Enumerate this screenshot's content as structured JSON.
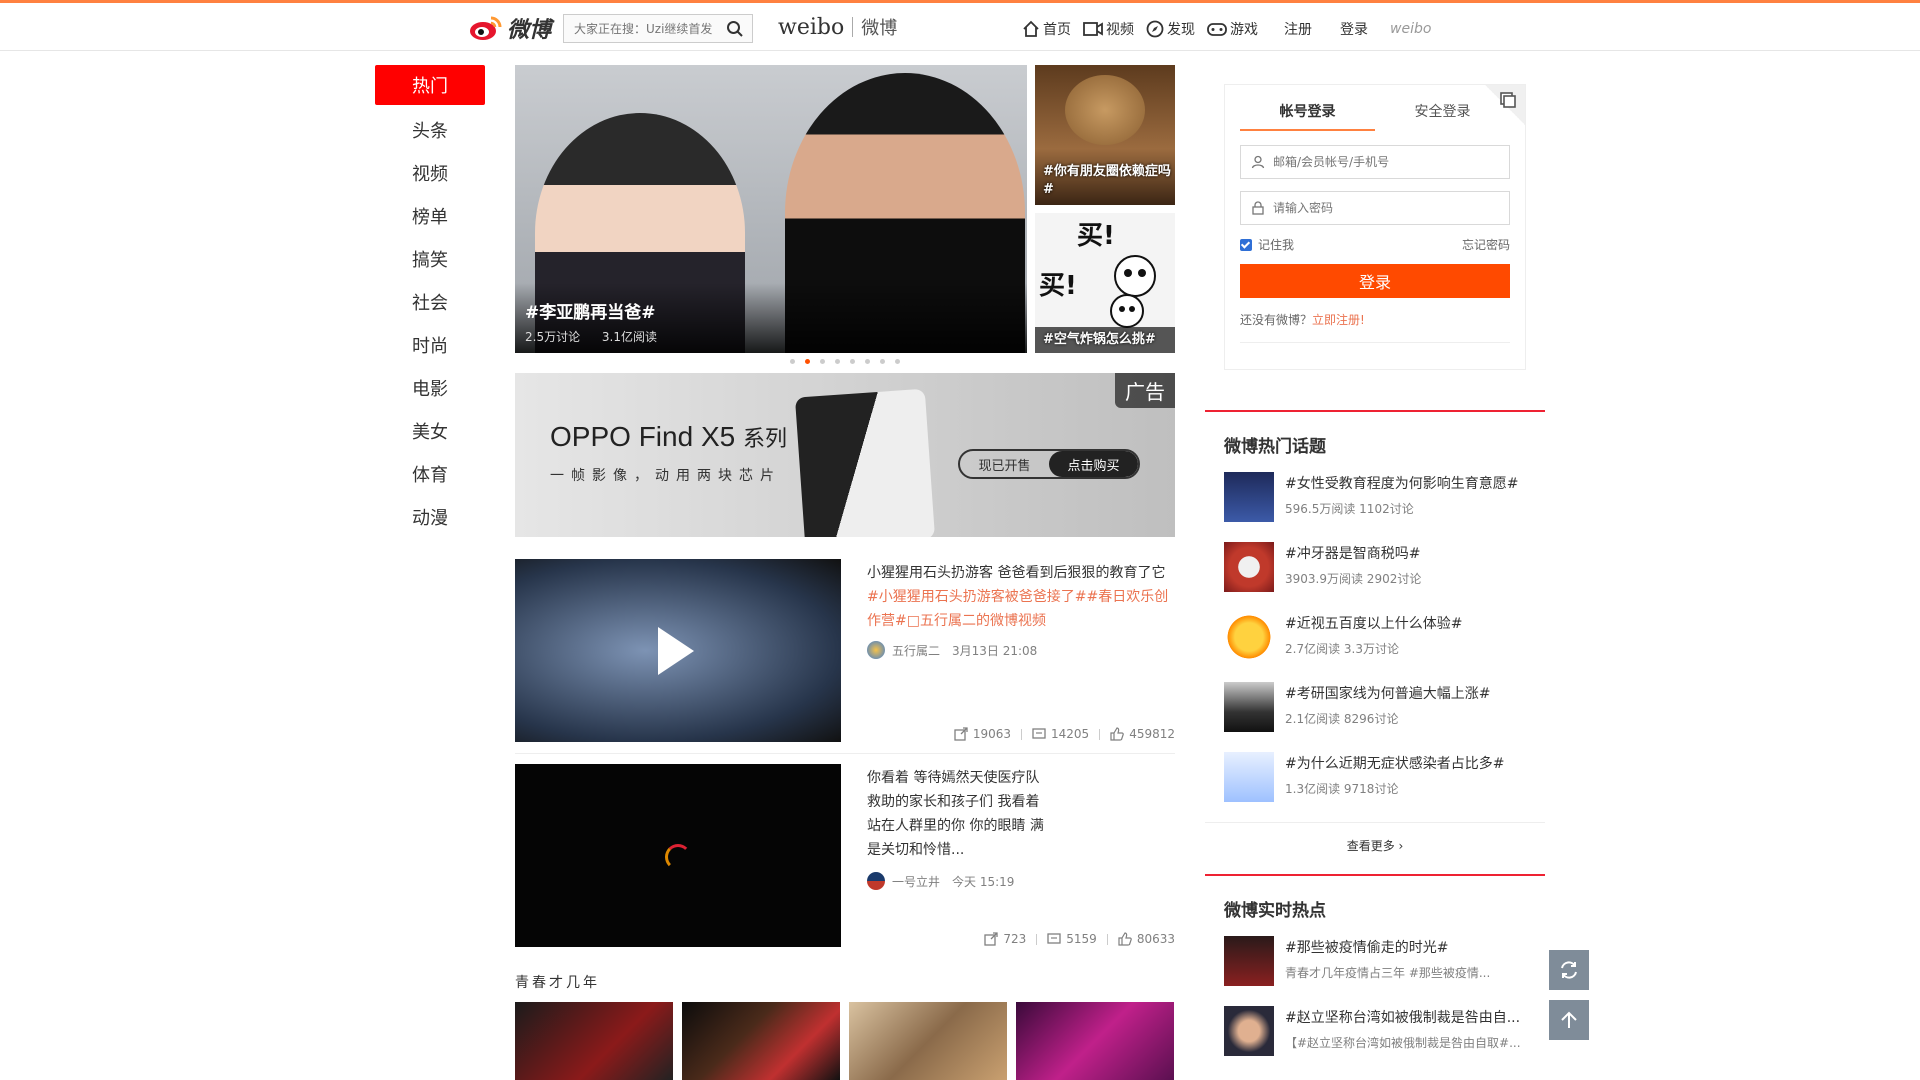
{
  "header": {
    "logo_text": "微博",
    "search_placeholder": "大家正在搜：Uzi继续首发",
    "brand_en": "weibo",
    "brand_cn": "微博",
    "nav": [
      {
        "label": "首页",
        "icon": "home-icon"
      },
      {
        "label": "视频",
        "icon": "video-icon"
      },
      {
        "label": "发现",
        "icon": "compass-icon"
      },
      {
        "label": "游戏",
        "icon": "gamepad-icon"
      }
    ],
    "register": "注册",
    "login": "登录",
    "weibo_small": "weibo"
  },
  "leftnav": [
    "热门",
    "头条",
    "视频",
    "榜单",
    "搞笑",
    "社会",
    "时尚",
    "电影",
    "美女",
    "体育",
    "动漫"
  ],
  "hero": {
    "title": "#李亚鹏再当爸#",
    "discussions": "2.5万讨论",
    "reads": "3.1亿阅读",
    "side": [
      {
        "title": "#你有朋友圈依赖症吗#"
      },
      {
        "title": "#空气炸锅怎么挑#",
        "buy1": "买!",
        "buy2": "买!"
      }
    ]
  },
  "ad": {
    "title": "OPPO Find X5",
    "title_suffix": "系列",
    "subtitle": "一帧影像，动用两块芯片",
    "tag": "广告",
    "btn1": "现已开售",
    "btn2": "点击购买"
  },
  "feed": [
    {
      "text": "小猩猩用石头扔游客 爸爸看到后狠狠的教育了它",
      "tags": "#小猩猩用石头扔游客被爸爸接了##春日欢乐创作营#",
      "link": "□五行属二的微博视频",
      "user": "五行属二",
      "time": "3月13日 21:08",
      "shares": "19063",
      "comments": "14205",
      "likes": "459812"
    },
    {
      "text": "你看着 等待嫣然天使医疗队 救助的家长和孩子们 我看着 站在人群里的你 你的眼睛 满是关切和怜惜...",
      "user": "一号立井",
      "time": "今天 15:19",
      "shares": "723",
      "comments": "5159",
      "likes": "80633"
    }
  ],
  "section_title": "青春才几年",
  "login": {
    "tab_account": "帐号登录",
    "tab_secure": "安全登录",
    "user_placeholder": "邮箱/会员帐号/手机号",
    "pass_placeholder": "请输入密码",
    "remember": "记住我",
    "forgot": "忘记密码",
    "button": "登录",
    "no_account": "还没有微博？",
    "register_now": "立即注册!"
  },
  "hot_topics": {
    "title": "微博热门话题",
    "items": [
      {
        "title": "#女性受教育程度为何影响生育意愿#",
        "meta": "596.5万阅读 1102讨论"
      },
      {
        "title": "#冲牙器是智商税吗#",
        "meta": "3903.9万阅读 2902讨论"
      },
      {
        "title": "#近视五百度以上什么体验#",
        "meta": "2.7亿阅读 3.3万讨论"
      },
      {
        "title": "#考研国家线为何普遍大幅上涨#",
        "meta": "2.1亿阅读 8296讨论"
      },
      {
        "title": "#为什么近期无症状感染者占比多#",
        "meta": "1.3亿阅读 9718讨论"
      }
    ],
    "more": "查看更多 ›"
  },
  "realtime": {
    "title": "微博实时热点",
    "items": [
      {
        "title": "#那些被疫情偷走的时光#",
        "meta": "青春才几年疫情占三年 #那些被疫情..."
      },
      {
        "title": "#赵立坚称台湾如被俄制裁是咎由自...",
        "meta": "【#赵立坚称台湾如被俄制裁是咎由自取#..."
      }
    ]
  }
}
